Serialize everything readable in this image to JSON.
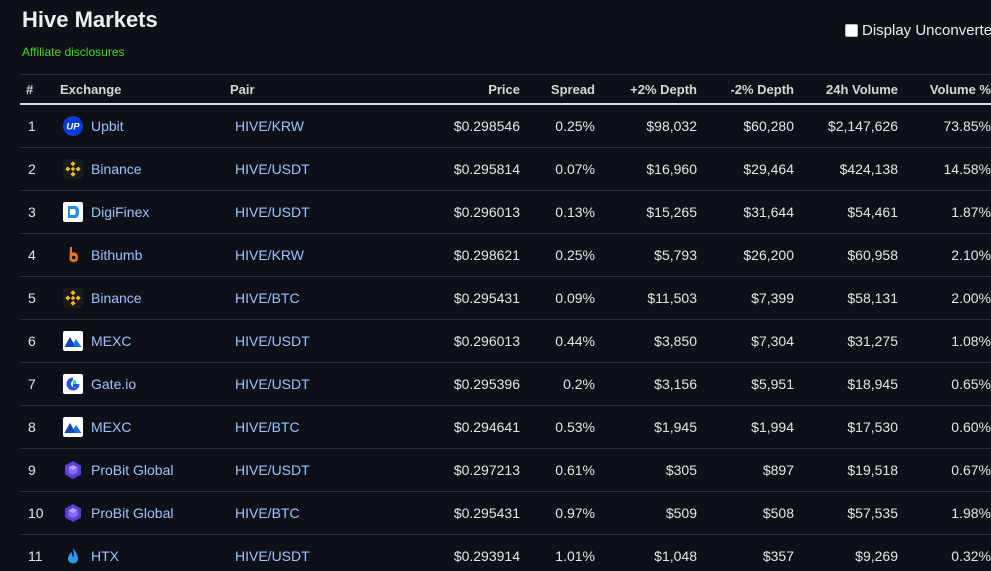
{
  "header": {
    "title": "Hive Markets",
    "affiliate_link": "Affiliate disclosures",
    "unconverted_label": "Display Unconverted"
  },
  "table": {
    "columns": [
      "#",
      "Exchange",
      "Pair",
      "Price",
      "Spread",
      "+2% Depth",
      "-2% Depth",
      "24h Volume",
      "Volume %"
    ],
    "rows": [
      {
        "rank": "1",
        "exchange": "Upbit",
        "icon": "upbit-icon",
        "pair": "HIVE/KRW",
        "price": "$0.298546",
        "spread": "0.25%",
        "depth_plus": "$98,032",
        "depth_minus": "$60,280",
        "volume": "$2,147,626",
        "volume_pct": "73.85%"
      },
      {
        "rank": "2",
        "exchange": "Binance",
        "icon": "binance-icon",
        "pair": "HIVE/USDT",
        "price": "$0.295814",
        "spread": "0.07%",
        "depth_plus": "$16,960",
        "depth_minus": "$29,464",
        "volume": "$424,138",
        "volume_pct": "14.58%"
      },
      {
        "rank": "3",
        "exchange": "DigiFinex",
        "icon": "digifinex-icon",
        "pair": "HIVE/USDT",
        "price": "$0.296013",
        "spread": "0.13%",
        "depth_plus": "$15,265",
        "depth_minus": "$31,644",
        "volume": "$54,461",
        "volume_pct": "1.87%"
      },
      {
        "rank": "4",
        "exchange": "Bithumb",
        "icon": "bithumb-icon",
        "pair": "HIVE/KRW",
        "price": "$0.298621",
        "spread": "0.25%",
        "depth_plus": "$5,793",
        "depth_minus": "$26,200",
        "volume": "$60,958",
        "volume_pct": "2.10%"
      },
      {
        "rank": "5",
        "exchange": "Binance",
        "icon": "binance-icon",
        "pair": "HIVE/BTC",
        "price": "$0.295431",
        "spread": "0.09%",
        "depth_plus": "$11,503",
        "depth_minus": "$7,399",
        "volume": "$58,131",
        "volume_pct": "2.00%"
      },
      {
        "rank": "6",
        "exchange": "MEXC",
        "icon": "mexc-icon",
        "pair": "HIVE/USDT",
        "price": "$0.296013",
        "spread": "0.44%",
        "depth_plus": "$3,850",
        "depth_minus": "$7,304",
        "volume": "$31,275",
        "volume_pct": "1.08%"
      },
      {
        "rank": "7",
        "exchange": "Gate.io",
        "icon": "gateio-icon",
        "pair": "HIVE/USDT",
        "price": "$0.295396",
        "spread": "0.2%",
        "depth_plus": "$3,156",
        "depth_minus": "$5,951",
        "volume": "$18,945",
        "volume_pct": "0.65%"
      },
      {
        "rank": "8",
        "exchange": "MEXC",
        "icon": "mexc-icon",
        "pair": "HIVE/BTC",
        "price": "$0.294641",
        "spread": "0.53%",
        "depth_plus": "$1,945",
        "depth_minus": "$1,994",
        "volume": "$17,530",
        "volume_pct": "0.60%"
      },
      {
        "rank": "9",
        "exchange": "ProBit Global",
        "icon": "probit-icon",
        "pair": "HIVE/USDT",
        "price": "$0.297213",
        "spread": "0.61%",
        "depth_plus": "$305",
        "depth_minus": "$897",
        "volume": "$19,518",
        "volume_pct": "0.67%"
      },
      {
        "rank": "10",
        "exchange": "ProBit Global",
        "icon": "probit-icon",
        "pair": "HIVE/BTC",
        "price": "$0.295431",
        "spread": "0.97%",
        "depth_plus": "$509",
        "depth_minus": "$508",
        "volume": "$57,535",
        "volume_pct": "1.98%"
      },
      {
        "rank": "11",
        "exchange": "HTX",
        "icon": "htx-icon",
        "pair": "HIVE/USDT",
        "price": "$0.293914",
        "spread": "1.01%",
        "depth_plus": "$1,048",
        "depth_minus": "$357",
        "volume": "$9,269",
        "volume_pct": "0.32%"
      }
    ]
  },
  "colors": {
    "background": "#0d1117",
    "affiliate_green": "#4cd31e",
    "link_blue": "#9ec3ff"
  }
}
